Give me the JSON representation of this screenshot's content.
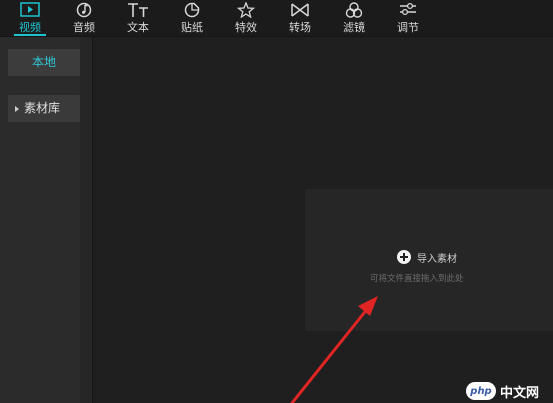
{
  "toolbar": {
    "tabs": [
      {
        "label": "视频",
        "icon": "video-icon",
        "active": true
      },
      {
        "label": "音频",
        "icon": "music-note-icon"
      },
      {
        "label": "文本",
        "icon": "text-icon"
      },
      {
        "label": "贴纸",
        "icon": "sticker-icon"
      },
      {
        "label": "特效",
        "icon": "effects-star-icon"
      },
      {
        "label": "转场",
        "icon": "transition-icon"
      },
      {
        "label": "滤镜",
        "icon": "filter-icon"
      },
      {
        "label": "调节",
        "icon": "adjust-sliders-icon"
      }
    ],
    "accent_color": "#1fc3d0"
  },
  "sidebar": {
    "local_label": "本地",
    "library_label": "素材库"
  },
  "main": {
    "import_label": "导入素材",
    "drop_hint": "可将文件直接拖入到此处"
  },
  "annotation": {
    "arrow_color": "#e02424"
  },
  "watermark": {
    "logo": "php",
    "text": "中文网"
  }
}
